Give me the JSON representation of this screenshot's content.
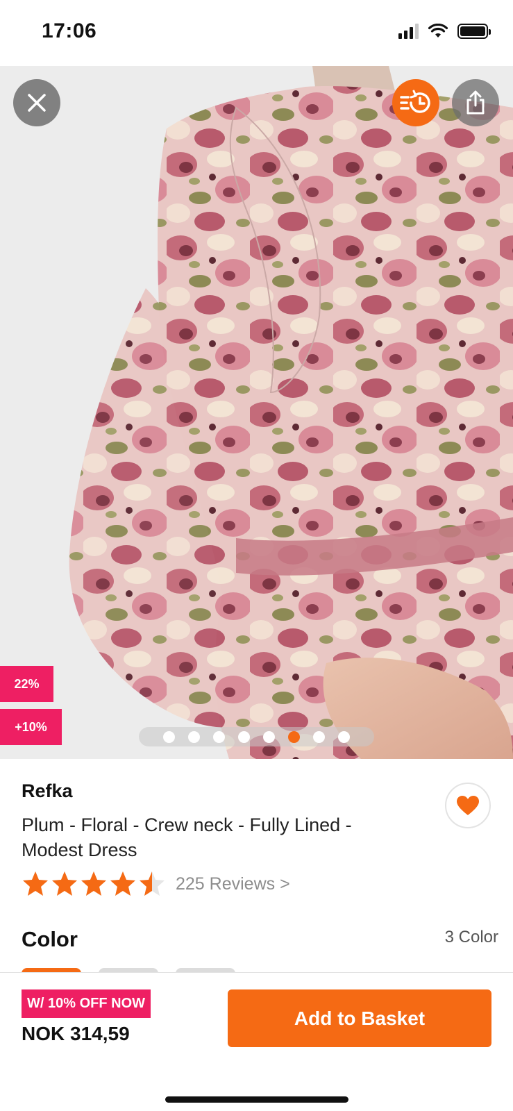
{
  "status_bar": {
    "time": "17:06"
  },
  "gallery": {
    "image_count": 8,
    "active_index": 5,
    "badges": {
      "discount": "22%",
      "extra": "+10%"
    }
  },
  "product": {
    "brand": "Refka",
    "title": "Plum - Floral - Crew neck - Fully Lined - Modest Dress",
    "rating": 4.5,
    "reviews_label": "225 Reviews >"
  },
  "color_section": {
    "label": "Color",
    "count": "3 Color"
  },
  "bottom_bar": {
    "promo": "W/ 10% OFF NOW",
    "price": "NOK 314,59",
    "add_to_basket": "Add to Basket"
  },
  "colors": {
    "accent": "#f56a14",
    "badge": "#ee1f63"
  },
  "icons": [
    "close-icon",
    "history-icon",
    "share-icon",
    "heart-icon",
    "star-icon"
  ]
}
